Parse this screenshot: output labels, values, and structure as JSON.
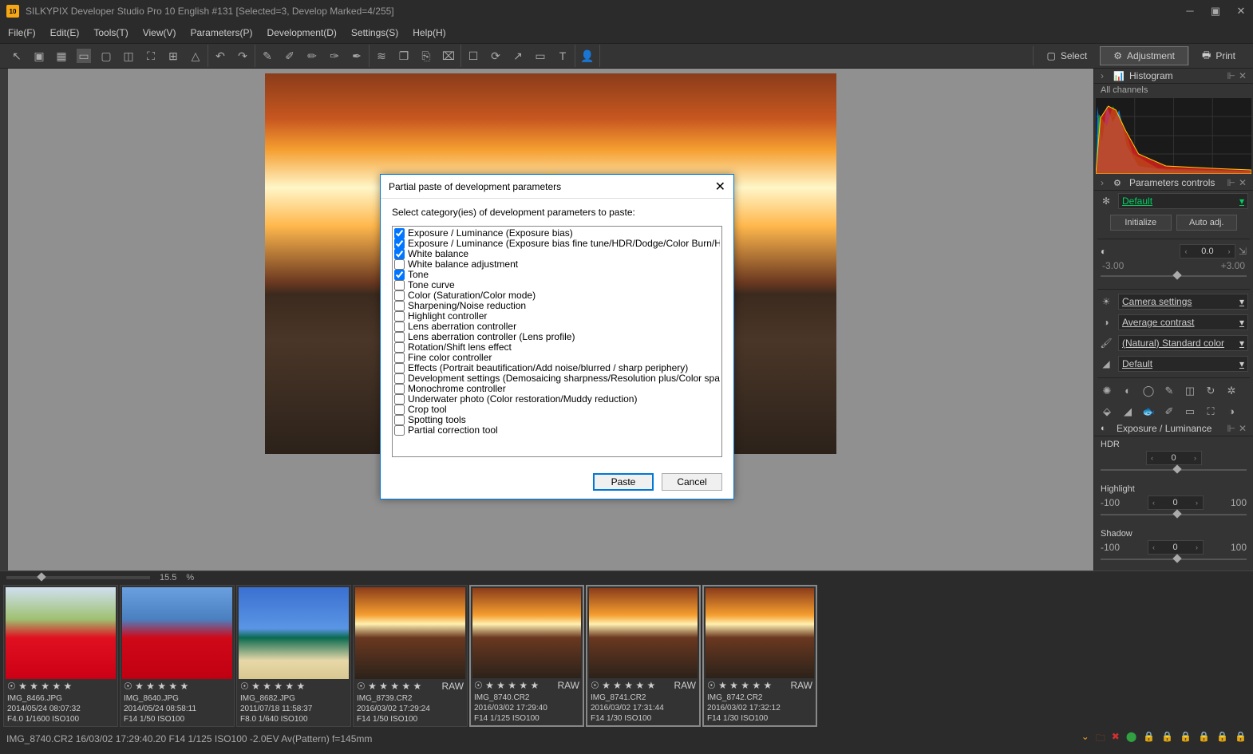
{
  "title": "SILKYPIX Developer Studio Pro 10 English   #131   [Selected=3, Develop Marked=4/255]",
  "menus": [
    "File(F)",
    "Edit(E)",
    "Tools(T)",
    "View(V)",
    "Parameters(P)",
    "Development(D)",
    "Settings(S)",
    "Help(H)"
  ],
  "rb": {
    "select": "Select",
    "adjustment": "Adjustment",
    "print": "Print"
  },
  "zoom": {
    "pct": "15.5",
    "unit": "%"
  },
  "panel": {
    "histogram": {
      "title": "Histogram",
      "channels": "All channels"
    },
    "params": {
      "title": "Parameters controls",
      "main_select": "Default",
      "initialize": "Initialize",
      "autoadj": "Auto adj.",
      "exp_val": "0.0",
      "exp_min": "-3.00",
      "exp_max": "+3.00",
      "wb": "Camera settings",
      "tone": "Average contrast",
      "color": "(Natural) Standard color",
      "sharp": "Default"
    },
    "exposure": {
      "title": "Exposure / Luminance",
      "hdr": "HDR",
      "hdr_v": "0",
      "hl": "Highlight",
      "hl_min": "-100",
      "hl_v": "0",
      "hl_max": "100",
      "sh": "Shadow",
      "sh_min": "-100",
      "sh_v": "0",
      "sh_max": "100"
    }
  },
  "dialog": {
    "title": "Partial paste of development parameters",
    "instr": "Select category(ies) of development parameters to paste:",
    "paste": "Paste",
    "cancel": "Cancel",
    "items": [
      {
        "c": true,
        "t": "Exposure / Luminance (Exposure bias)"
      },
      {
        "c": true,
        "t": "Exposure / Luminance (Exposure bias fine tune/HDR/Dodge/Color Burn/Highlight/Shado"
      },
      {
        "c": true,
        "t": "White balance"
      },
      {
        "c": false,
        "t": "White balance adjustment"
      },
      {
        "c": true,
        "t": "Tone"
      },
      {
        "c": false,
        "t": "Tone curve"
      },
      {
        "c": false,
        "t": "Color (Saturation/Color mode)"
      },
      {
        "c": false,
        "t": "Sharpening/Noise reduction"
      },
      {
        "c": false,
        "t": "Highlight controller"
      },
      {
        "c": false,
        "t": "Lens aberration controller"
      },
      {
        "c": false,
        "t": "Lens aberration controller (Lens profile)"
      },
      {
        "c": false,
        "t": "Rotation/Shift lens effect"
      },
      {
        "c": false,
        "t": "Fine color controller"
      },
      {
        "c": false,
        "t": "Effects (Portrait beautification/Add noise/blurred / sharp periphery)"
      },
      {
        "c": false,
        "t": "Development settings (Demosaicing sharpness/Resolution plus/Color space)"
      },
      {
        "c": false,
        "t": "Monochrome controller"
      },
      {
        "c": false,
        "t": "Underwater photo (Color restoration/Muddy reduction)"
      },
      {
        "c": false,
        "t": "Crop tool"
      },
      {
        "c": false,
        "t": "Spotting tools"
      },
      {
        "c": false,
        "t": "Partial correction tool"
      }
    ]
  },
  "thumbs": [
    {
      "file": "IMG_8466.JPG",
      "date": "2014/05/24 08:07:32",
      "exif": "F4.0 1/1600 ISO100",
      "raw": "",
      "sel": false,
      "g": "g-flowers"
    },
    {
      "file": "IMG_8640.JPG",
      "date": "2014/05/24 08:58:11",
      "exif": "F14 1/50 ISO100",
      "raw": "",
      "sel": false,
      "g": "g-poppies"
    },
    {
      "file": "IMG_8682.JPG",
      "date": "2011/07/18 11:58:37",
      "exif": "F8.0 1/640 ISO100",
      "raw": "",
      "sel": false,
      "g": "g-beach"
    },
    {
      "file": "IMG_8739.CR2",
      "date": "2016/03/02 17:29:24",
      "exif": "F14 1/50 ISO100",
      "raw": "RAW",
      "sel": false,
      "g": "g-sunset"
    },
    {
      "file": "IMG_8740.CR2",
      "date": "2016/03/02 17:29:40",
      "exif": "F14 1/125 ISO100",
      "raw": "RAW",
      "sel": true,
      "g": "g-sunset"
    },
    {
      "file": "IMG_8741.CR2",
      "date": "2016/03/02 17:31:44",
      "exif": "F14 1/30 ISO100",
      "raw": "RAW",
      "sel": true,
      "g": "g-sunset"
    },
    {
      "file": "IMG_8742.CR2",
      "date": "2016/03/02 17:32:12",
      "exif": "F14 1/30 ISO100",
      "raw": "RAW",
      "sel": true,
      "g": "g-sunset"
    }
  ],
  "status": "IMG_8740.CR2 16/03/02 17:29:40.20 F14 1/125 ISO100 -2.0EV Av(Pattern) f=145mm"
}
